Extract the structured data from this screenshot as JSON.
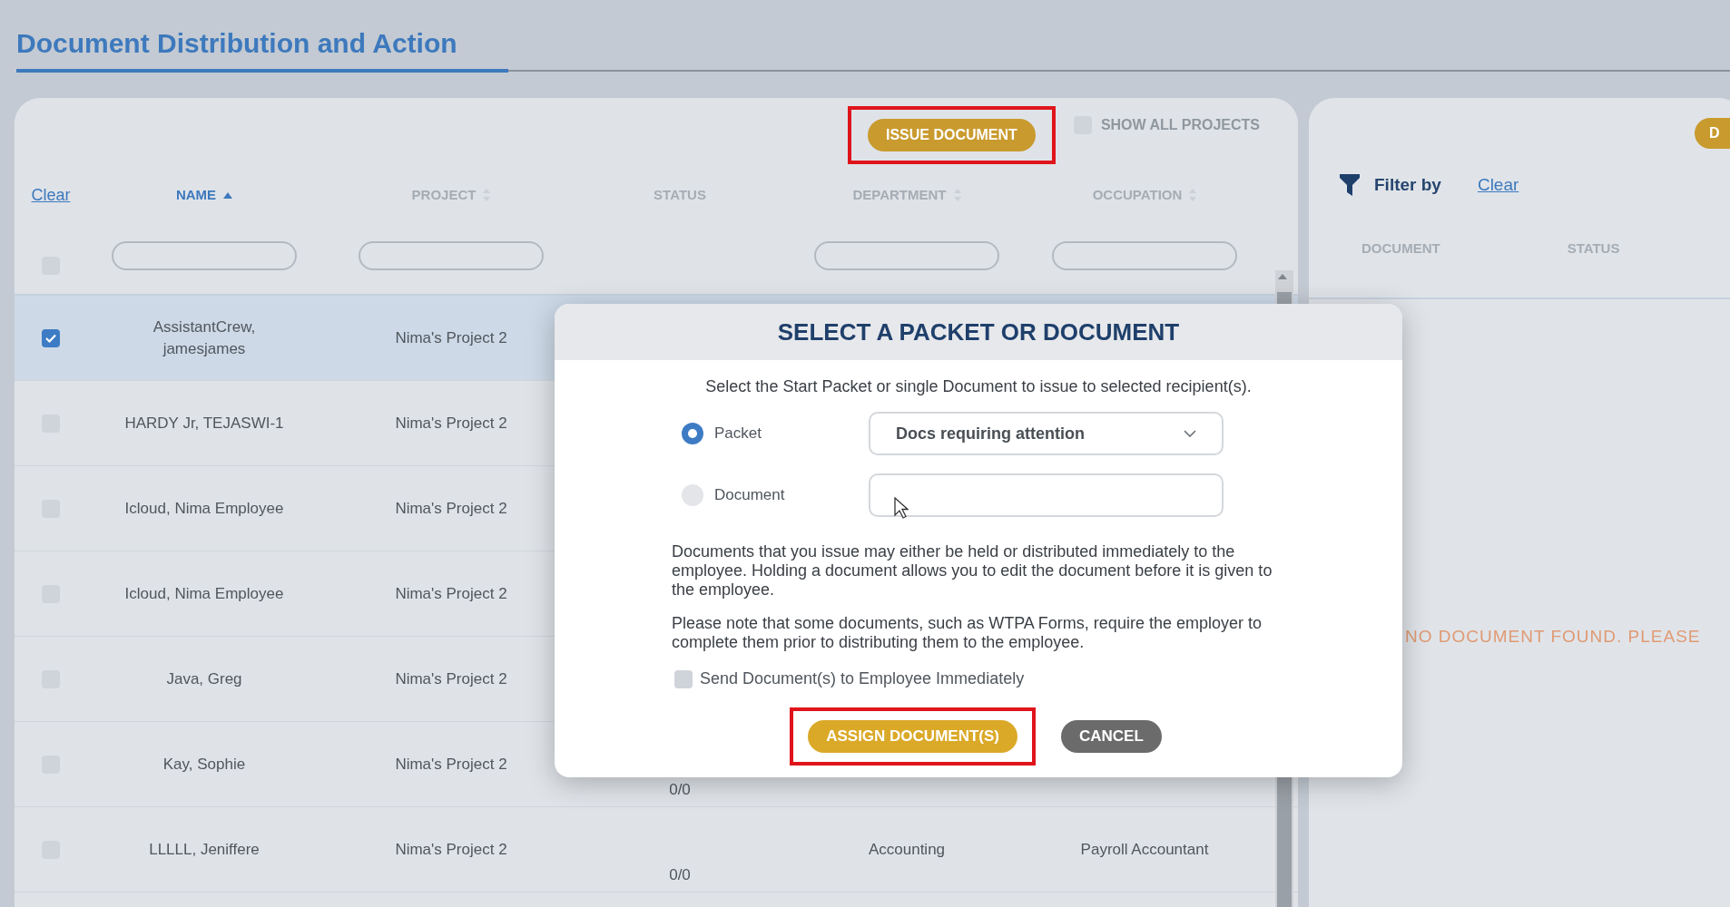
{
  "page": {
    "title": "Document Distribution and Action"
  },
  "employees": {
    "issue_button": {
      "label": "ISSUE DOCUMENT",
      "highlighted": true
    },
    "show_all_projects": {
      "label": "SHOW ALL PROJECTS",
      "checked": false
    },
    "clear_link": "Clear",
    "select_all": {
      "checked": false
    },
    "columns": [
      {
        "label": "NAME",
        "sortable": true,
        "sorted": true,
        "filter": true
      },
      {
        "label": "PROJECT",
        "sortable": true,
        "sorted": false,
        "filter": true
      },
      {
        "label": "STATUS",
        "sortable": false,
        "sorted": false,
        "filter": false
      },
      {
        "label": "DEPARTMENT",
        "sortable": true,
        "sorted": false,
        "filter": true
      },
      {
        "label": "OCCUPATION",
        "sortable": true,
        "sorted": false,
        "filter": true
      }
    ],
    "rows": [
      {
        "selected": true,
        "name": "AssistantCrew, jamesjames",
        "project": "Nima's Project 2"
      },
      {
        "selected": false,
        "name": "HARDY Jr, TEJASWI-1",
        "project": "Nima's Project 2"
      },
      {
        "selected": false,
        "name": "Icloud, Nima Employee",
        "project": "Nima's Project 2"
      },
      {
        "selected": false,
        "name": "Icloud, Nima Employee",
        "project": "Nima's Project 2"
      },
      {
        "selected": false,
        "name": "Java, Greg",
        "project": "Nima's Project 2"
      },
      {
        "selected": false,
        "name": "Kay, Sophie",
        "project": "Nima's Project 2",
        "status": "0/0"
      },
      {
        "selected": false,
        "name": "LLLLL, Jeniffere",
        "project": "Nima's Project 2",
        "status": "0/0",
        "department": "Accounting",
        "occupation": "Payroll Accountant"
      }
    ]
  },
  "documents": {
    "action_button": "D",
    "filter_label": "Filter by",
    "clear_link": "Clear",
    "columns": [
      "DOCUMENT",
      "STATUS"
    ],
    "empty_message": "NO DOCUMENT FOUND. PLEASE"
  },
  "modal": {
    "title": "SELECT A PACKET OR DOCUMENT",
    "intro": "Select the Start Packet or single Document to issue to selected recipient(s).",
    "options": [
      {
        "label": "Packet",
        "selected": true,
        "kind": "dropdown",
        "value": "Docs requiring attention"
      },
      {
        "label": "Document",
        "selected": false,
        "kind": "text"
      }
    ],
    "notes": [
      "Documents that you issue may either be held or distributed immediately to the employee. Holding a document allows you to edit the document before it is given to the employee.",
      "Please note that some documents, such as WTPA Forms, require the employer to complete them prior to distributing them to the employee."
    ],
    "send_immediately": {
      "label": "Send Document(s) to Employee Immediately",
      "checked": false
    },
    "buttons": [
      {
        "label": "ASSIGN DOCUMENT(S)",
        "kind": "primary",
        "highlighted": true
      },
      {
        "label": "CANCEL",
        "kind": "secondary",
        "highlighted": false
      }
    ]
  }
}
